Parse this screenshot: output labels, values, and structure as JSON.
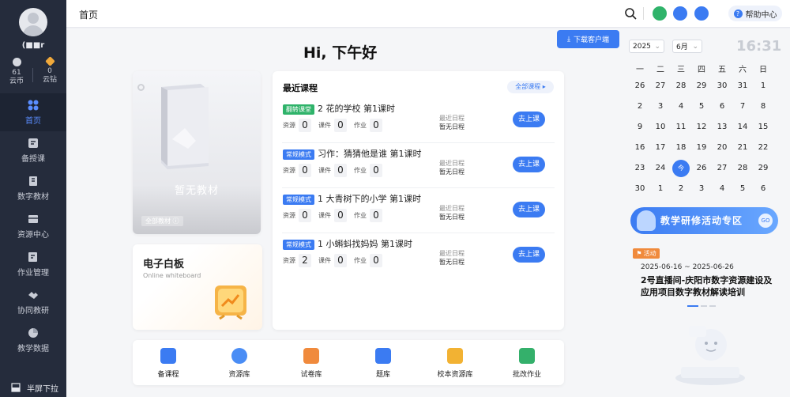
{
  "user": {
    "name": "(■■r",
    "coins_label": "云币",
    "coins": "61",
    "diamonds_label": "云钻",
    "diamonds": "0"
  },
  "nav": [
    {
      "label": "首页",
      "icon": "home-grid-icon",
      "active": true
    },
    {
      "label": "备授课",
      "icon": "prepare-icon"
    },
    {
      "label": "数字教材",
      "icon": "book-icon"
    },
    {
      "label": "资源中心",
      "icon": "resource-icon"
    },
    {
      "label": "作业管理",
      "icon": "homework-icon"
    },
    {
      "label": "协同教研",
      "icon": "handshake-icon"
    },
    {
      "label": "教学数据",
      "icon": "pie-icon"
    }
  ],
  "sidebar_footer": "半屏下拉",
  "topbar": {
    "breadcrumb": "首页",
    "help": "帮助中心"
  },
  "greeting": "Hi, 下午好",
  "download_client": "下载客户端",
  "textbook": {
    "empty_text": "暂无教材",
    "all_label": "全部教材"
  },
  "whiteboard": {
    "title": "电子白板",
    "subtitle": "Online whiteboard"
  },
  "courses": {
    "title": "最近课程",
    "all_label": "全部课程",
    "stat_labels": {
      "resource": "资源",
      "courseware": "课件",
      "homework": "作业"
    },
    "schedule_label": "最近日程",
    "go_label": "去上课",
    "items": [
      {
        "badge": "翻转课堂",
        "badge_color": "#2fb36a",
        "title": "2 花的学校 第1课时",
        "resource": "0",
        "courseware": "0",
        "homework": "0",
        "schedule": "暂无日程"
      },
      {
        "badge": "常规模式",
        "badge_color": "#3b7bf2",
        "title": "习作：猜猜他是谁 第1课时",
        "resource": "0",
        "courseware": "0",
        "homework": "0",
        "schedule": "暂无日程"
      },
      {
        "badge": "常规模式",
        "badge_color": "#3b7bf2",
        "title": "1 大青树下的小学 第1课时",
        "resource": "0",
        "courseware": "0",
        "homework": "0",
        "schedule": "暂无日程"
      },
      {
        "badge": "常规模式",
        "badge_color": "#3b7bf2",
        "title": "1 小蝌蚪找妈妈 第1课时",
        "resource": "2",
        "courseware": "0",
        "homework": "0",
        "schedule": "暂无日程"
      }
    ]
  },
  "dock": [
    {
      "label": "备课程",
      "color": "#3b7bf2"
    },
    {
      "label": "资源库",
      "color": "#4a8df5"
    },
    {
      "label": "试卷库",
      "color": "#f08a3c"
    },
    {
      "label": "题库",
      "color": "#3b7bf2"
    },
    {
      "label": "校本资源库",
      "color": "#f2b233"
    },
    {
      "label": "批改作业",
      "color": "#34b06b"
    }
  ],
  "calendar": {
    "year": "2025",
    "month": "6月",
    "time": "16:31",
    "weekdays": [
      "一",
      "二",
      "三",
      "四",
      "五",
      "六",
      "日"
    ],
    "days": [
      [
        "26",
        "27",
        "28",
        "29",
        "30",
        "31",
        "1"
      ],
      [
        "2",
        "3",
        "4",
        "5",
        "6",
        "7",
        "8"
      ],
      [
        "9",
        "10",
        "11",
        "12",
        "13",
        "14",
        "15"
      ],
      [
        "16",
        "17",
        "18",
        "19",
        "20",
        "21",
        "22"
      ],
      [
        "23",
        "24",
        "今",
        "26",
        "27",
        "28",
        "29"
      ],
      [
        "30",
        "1",
        "2",
        "3",
        "4",
        "5",
        "6"
      ]
    ]
  },
  "banner": {
    "text": "教学研修活动专区"
  },
  "activity": {
    "tag": "活动",
    "dates": "2025-06-16 ~ 2025-06-26",
    "title": "2号直播间-庆阳市数字资源建设及应用项目数字教材解读培训"
  }
}
